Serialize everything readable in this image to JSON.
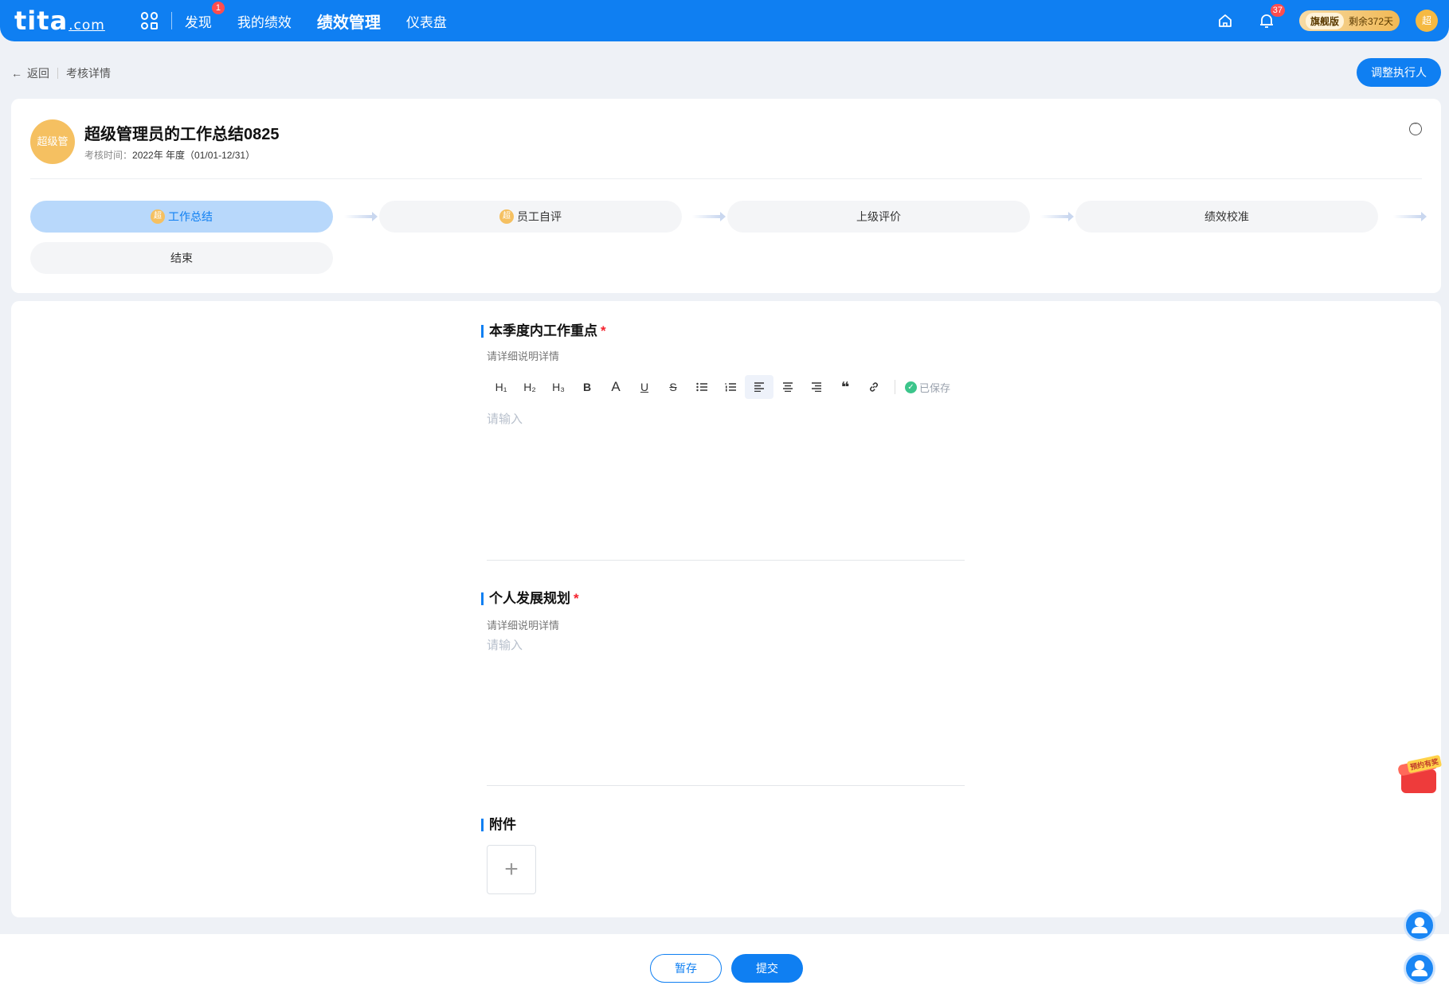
{
  "nav": {
    "logo": "tita",
    "logo_suffix": ".com",
    "items": [
      {
        "label": "发现",
        "badge": "1"
      },
      {
        "label": "我的绩效"
      },
      {
        "label": "绩效管理",
        "active": true
      },
      {
        "label": "仪表盘"
      }
    ],
    "notification_count": "37",
    "plan_label": "旗舰版",
    "plan_remaining": "剩余372天",
    "user_avatar_text": "超"
  },
  "breadcrumb": {
    "back_label": "返回",
    "current": "考核详情"
  },
  "adjust_button_label": "调整执行人",
  "header": {
    "avatar_text": "超级管",
    "title": "超级管理员的工作总结0825",
    "period_label": "考核时间：",
    "period_value": "2022年 年度（01/01-12/31）"
  },
  "steps": [
    {
      "label": "工作总结",
      "dot": "超",
      "active": true
    },
    {
      "label": "员工自评",
      "dot": "超"
    },
    {
      "label": "上级评价"
    },
    {
      "label": "绩效校准"
    },
    {
      "label": "结束"
    }
  ],
  "sections": {
    "focus": {
      "title": "本季度内工作重点",
      "required_mark": "*",
      "hint": "请详细说明详情",
      "placeholder": "请输入"
    },
    "plan": {
      "title": "个人发展规划",
      "required_mark": "*",
      "hint": "请详细说明详情",
      "placeholder": "请输入"
    },
    "attachment": {
      "title": "附件",
      "add_symbol": "+"
    }
  },
  "toolbar": {
    "items": [
      "H1",
      "H2",
      "H3",
      "B",
      "A",
      "U",
      "S",
      "bulleted-list",
      "numbered-list",
      "align-left",
      "align-center",
      "align-right",
      "quote",
      "link"
    ],
    "labels": {
      "h1": "H₁",
      "h2": "H₂",
      "h3": "H₃",
      "bold": "B",
      "color": "A",
      "underline": "U",
      "strike": "S",
      "quote": "❝"
    },
    "saved_label": "已保存"
  },
  "footer": {
    "draft_label": "暂存",
    "submit_label": "提交"
  },
  "gift": {
    "tag": "预约有奖"
  },
  "colors": {
    "primary": "#0f7ff2",
    "active_step_bg": "#b8d8fb",
    "required": "#f5222d",
    "saved_check": "#3cc58b",
    "avatar": "#f5c061"
  }
}
